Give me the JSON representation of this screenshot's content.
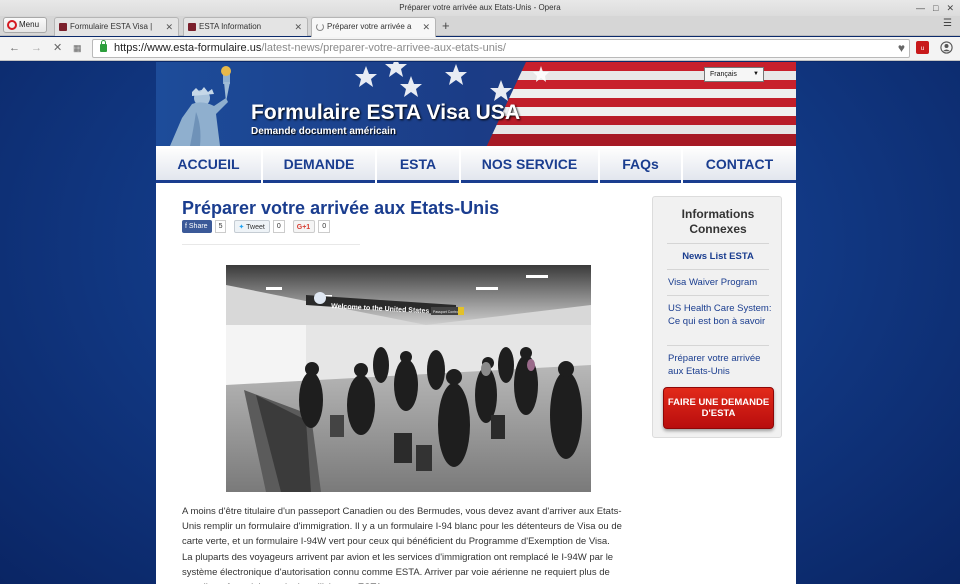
{
  "browser": {
    "window_title": "Préparer votre arrivée aux Etats-Unis - Opera",
    "menu_label": "Menu",
    "tabs": [
      {
        "title": "Formulaire ESTA Visa | "
      },
      {
        "title": "ESTA Information"
      },
      {
        "title": "Préparer votre arrivée a"
      }
    ],
    "url_host": "https://www.esta-formulaire.us",
    "url_path": "/latest-news/preparer-votre-arrivee-aux-etats-unis/"
  },
  "site": {
    "language_select": "Français",
    "title": "Formulaire ESTA Visa USA",
    "subtitle": "Demande document américain",
    "nav": [
      {
        "label": "ACCUEIL"
      },
      {
        "label": "DEMANDE"
      },
      {
        "label": "ESTA"
      },
      {
        "label": "NOS SERVICE"
      },
      {
        "label": "FAQs"
      },
      {
        "label": "CONTACT"
      }
    ]
  },
  "article": {
    "title": "Préparer votre arrivée aux Etats-Unis",
    "share": {
      "facebook_label": "Share",
      "facebook_count": "5",
      "twitter_label": "Tweet",
      "twitter_count": "0",
      "gplus_label": "G+1",
      "gplus_count": "0"
    },
    "photo_sign_text": "Welcome to the United States",
    "photo_sign_right": "Passport Control",
    "body": "A moins d'être titulaire d'un passeport Canadien ou des Bermudes, vous devez avant d'arriver aux Etats-Unis remplir un formulaire d'immigration. Il y a un formulaire I-94 blanc pour les détenteurs de Visa ou de carte verte, et un formulaire I-94W vert pour ceux qui bénéficient du Programme d'Exemption de Visa. La pluparts des voyageurs arrivent par avion et les services d'immigration ont remplacé le I-94W par le système électronique d'autorisation connu comme ESTA. Arriver par voie aérienne ne requiert plus de remplir un formulaire mais de solliciter un ESTA."
  },
  "sidebar": {
    "title": "Informations Connexes",
    "links": [
      {
        "label": "News List ESTA"
      },
      {
        "label": "Visa Waiver Program"
      },
      {
        "label": "US Health Care System: Ce qui est bon à savoir"
      },
      {
        "label": "Préparer votre arrivée aux Etats-Unis"
      }
    ],
    "cta": "FAIRE UNE DEMANDE D'ESTA"
  },
  "colors": {
    "brand_blue": "#1a3d8f",
    "cta_red": "#d41b1b",
    "page_background": "#123a86"
  },
  "icons": [
    "opera-logo-icon",
    "site-favicon",
    "loading-spinner-icon",
    "close-icon",
    "new-tab-icon",
    "tab-menu-icon",
    "back-icon",
    "forward-icon",
    "stop-icon",
    "speed-dial-icon",
    "lock-icon",
    "heart-icon",
    "adblock-icon",
    "account-icon",
    "dropdown-arrow-icon",
    "facebook-icon",
    "twitter-icon",
    "googleplus-icon"
  ]
}
